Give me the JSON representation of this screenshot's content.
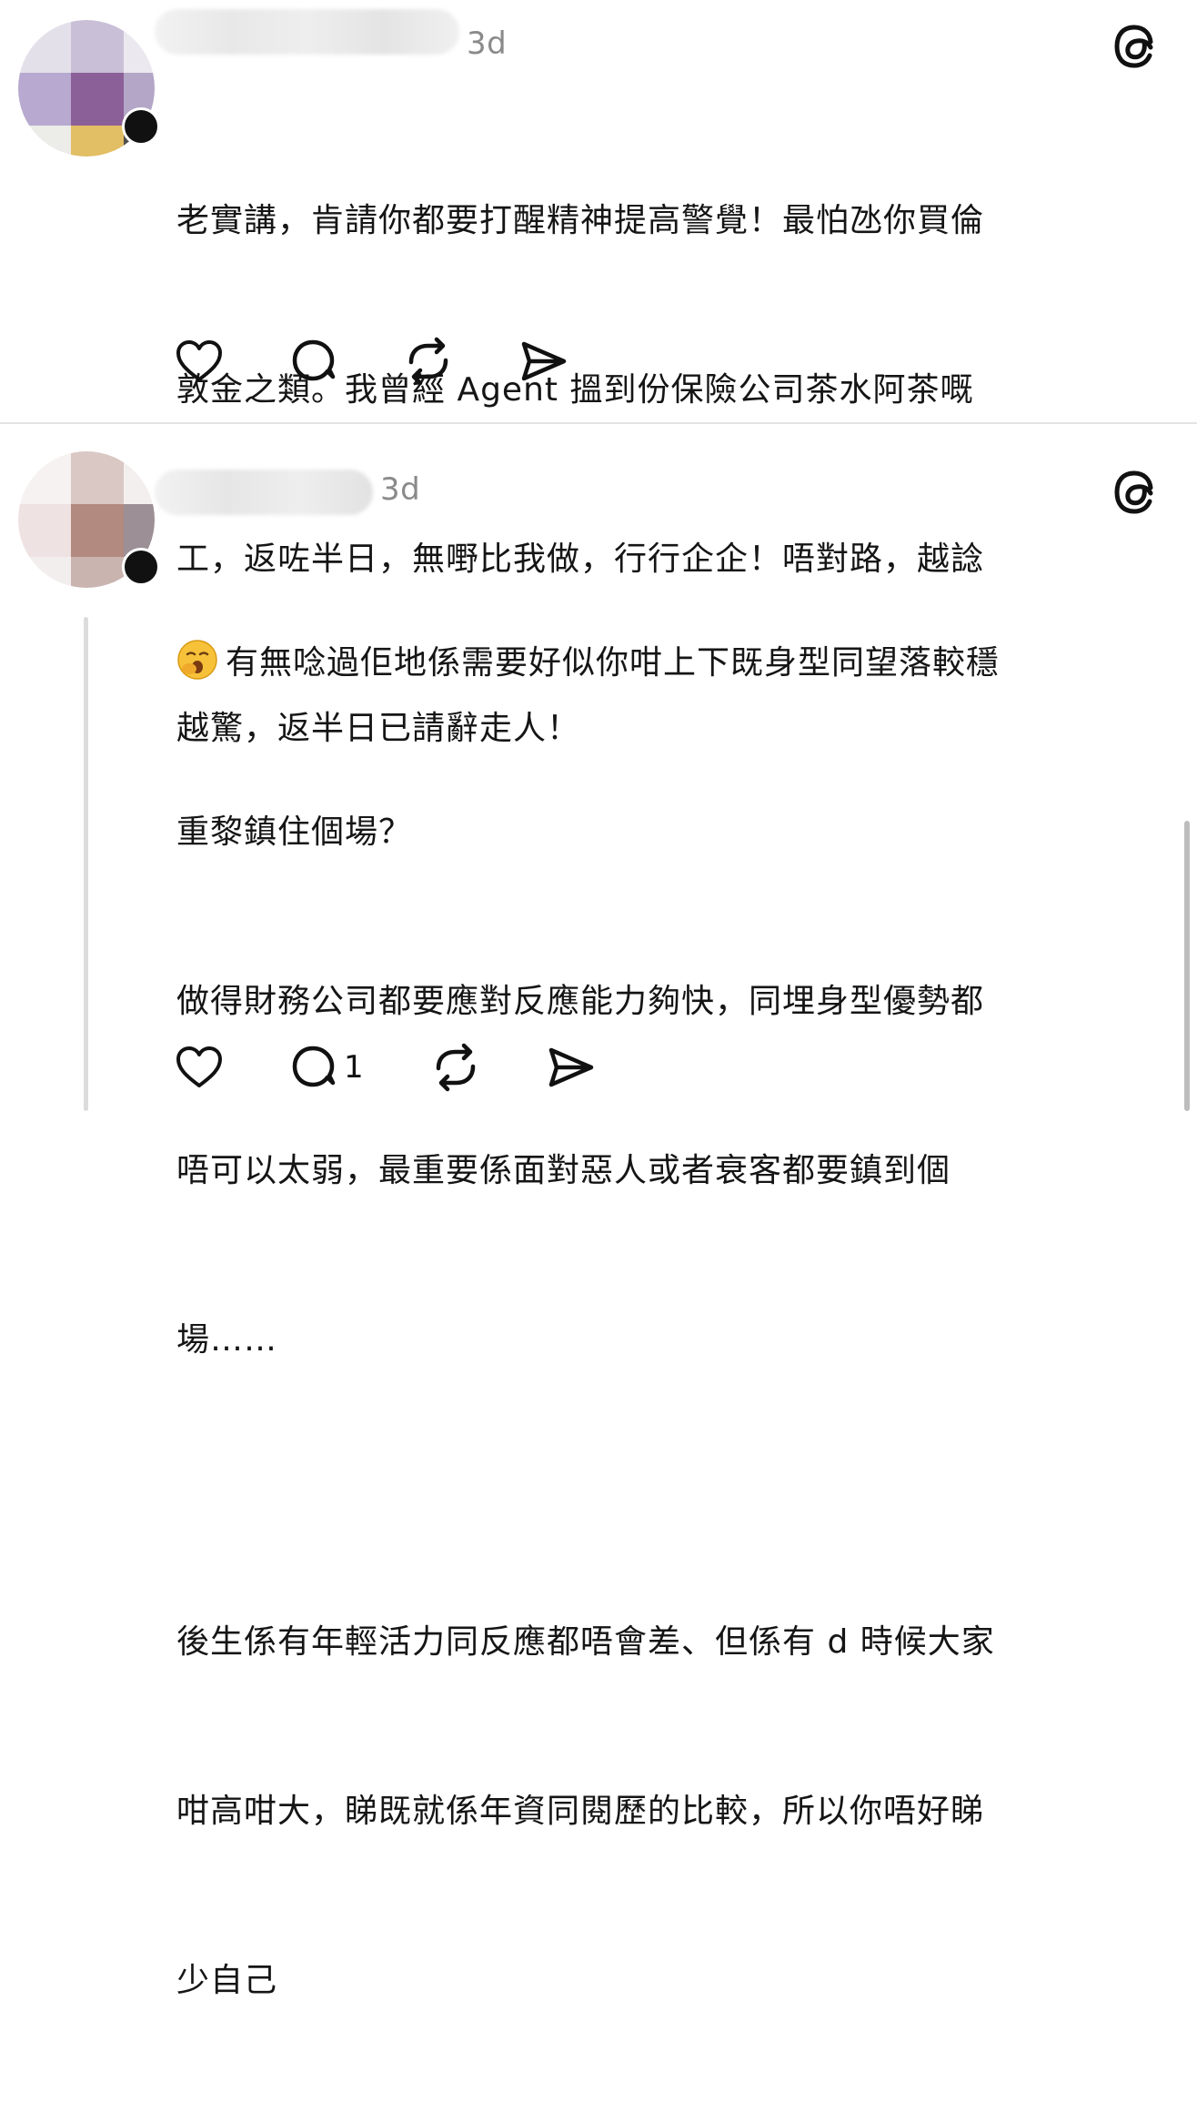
{
  "posts": [
    {
      "time": "3d",
      "body_lines": [
        "老實講，肯請你都要打醒精神提高警覺！最怕氹你買倫",
        "敦金之類。我曾經 Agent 搵到份保險公司茶水阿茶嘅",
        "工，返咗半日，無嘢比我做，行行企企！唔對路，越諗",
        "越驚，返半日已請辭走人！"
      ],
      "actions": {
        "like_icon": "heart-icon",
        "reply_icon": "comment-icon",
        "repost_icon": "repost-icon",
        "share_icon": "send-icon"
      }
    },
    {
      "time": "3d",
      "emoji": "yawning-face-emoji",
      "para1_lines": [
        "有無唸過佢地係需要好似你咁上下既身型同望落較穩",
        "重黎鎮住個場？"
      ],
      "para2_lines": [
        "做得財務公司都要應對反應能力夠快，同埋身型優勢都",
        "唔可以太弱，最重要係面對惡人或者衰客都要鎮到個",
        "場……"
      ],
      "para3_lines": [
        "後生係有年輕活力同反應都唔會差、但係有 d 時候大家",
        "咁高咁大，睇既就係年資同閱歷的比較，所以你唔好睇",
        "少自己"
      ],
      "reply_count": "1"
    }
  ],
  "colors": {
    "accent": "#111111",
    "muted": "#8a8a8a",
    "divider": "#e3e3e3"
  }
}
